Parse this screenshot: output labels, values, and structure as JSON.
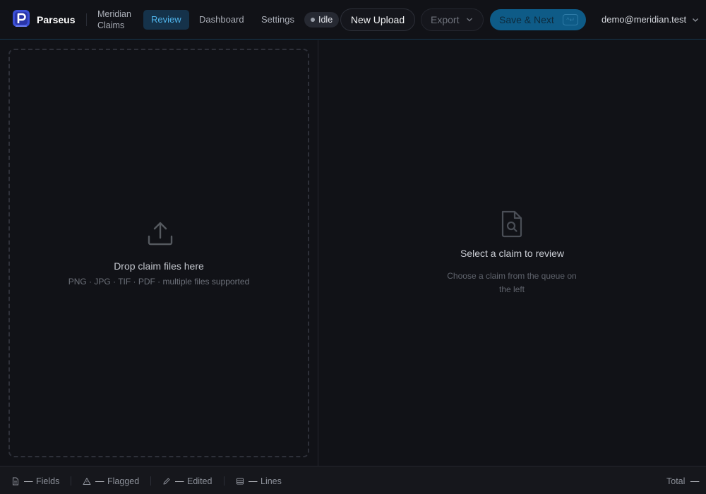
{
  "app": {
    "brand": "Parseus",
    "workspace": "Meridian Claims",
    "user_email": "demo@meridian.test",
    "accent_color": "#4fb3ea",
    "primary_color": "#0e5b87"
  },
  "nav": {
    "tabs": [
      {
        "label": "Review",
        "active": true
      },
      {
        "label": "Dashboard",
        "active": false
      },
      {
        "label": "Settings",
        "active": false
      }
    ]
  },
  "toolbar": {
    "status": "Idle",
    "upload_label": "New Upload",
    "export_label": "Export",
    "save_label": "Save & Next",
    "save_shortcut": "^↵"
  },
  "dropzone": {
    "title": "Drop claim files here",
    "subtitle": "PNG · JPG · TIF · PDF · multiple files supported",
    "icon": "upload-icon"
  },
  "empty_state": {
    "title": "Select a claim to review",
    "subtitle": "Choose a claim from the queue on the left",
    "icon": "document-search-icon"
  },
  "statusbar": {
    "fields": {
      "value": "—",
      "label": "Fields"
    },
    "flagged": {
      "value": "—",
      "label": "Flagged"
    },
    "edited": {
      "value": "—",
      "label": "Edited"
    },
    "lines": {
      "value": "—",
      "label": "Lines"
    },
    "total": {
      "label": "Total",
      "value": "—"
    }
  }
}
